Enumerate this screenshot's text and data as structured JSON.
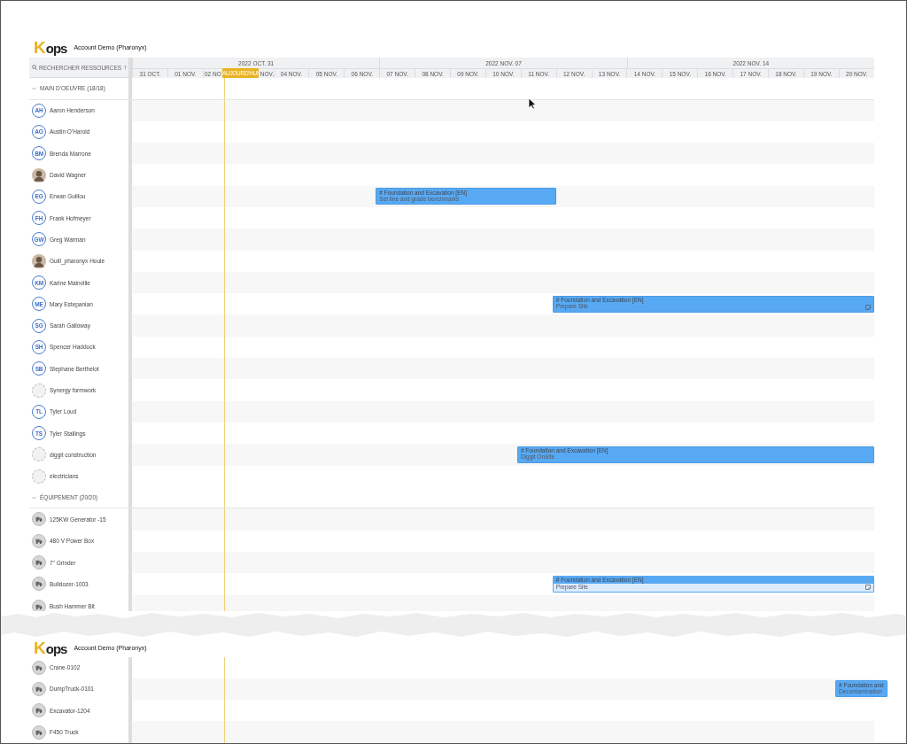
{
  "search": {
    "placeholder": "RECHERCHER RESSOURCES"
  },
  "timeline": {
    "weeks": [
      "2022 OCT. 31",
      "2022 NOV. 07",
      "2022 NOV. 14"
    ],
    "days": [
      "31 OCT.",
      "01 NOV.",
      "02 NO",
      "NOV.",
      "04 NOV.",
      "05 NOV.",
      "06 NOV.",
      "07 NOV.",
      "08 NOV.",
      "09 NOV.",
      "10 NOV.",
      "11 NOV.",
      "12 NOV.",
      "13 NOV.",
      "14 NOV.",
      "15 NOV.",
      "16 NOV.",
      "17 NOV.",
      "18 NOV.",
      "19 NOV.",
      "20 NOV."
    ],
    "today": {
      "label": "AUJOURD'HUI",
      "level": 0.1238
    }
  },
  "segments": [
    {
      "show_header": true,
      "header": {
        "logo": {
          "mark": "K",
          "text": "ops"
        },
        "account": "Account Demo (Pharonyx)"
      },
      "show_columns": true,
      "torn_below": true,
      "groups": [
        {
          "label": "MAIN D'OEUVRE (18/18)",
          "expanded": true,
          "rows": [
            {
              "name": "Aaron Henderson",
              "avatar": {
                "kind": "initials",
                "text": "AH"
              }
            },
            {
              "name": "Austin O'Harold",
              "avatar": {
                "kind": "initials",
                "text": "AO"
              }
            },
            {
              "name": "Brenda Marrone",
              "avatar": {
                "kind": "initials",
                "text": "BM"
              }
            },
            {
              "name": "David Wagner",
              "avatar": {
                "kind": "photo"
              }
            },
            {
              "name": "Erwan Guillou",
              "avatar": {
                "kind": "initials",
                "text": "EG"
              },
              "tasks": [
                {
                  "kind": "solid",
                  "title": "# Foundation and Excavation [EN]",
                  "subtitle": "Set line and grade benchmarks",
                  "note_icon": false
                }
              ]
            },
            {
              "name": "Frank Hofmeyer",
              "avatar": {
                "kind": "initials",
                "text": "FH"
              }
            },
            {
              "name": "Greg Warman",
              "avatar": {
                "kind": "initials",
                "text": "GW"
              }
            },
            {
              "name": "Guill_pharonyx Houle",
              "avatar": {
                "kind": "photo"
              }
            },
            {
              "name": "Karine Mainville",
              "avatar": {
                "kind": "initials",
                "text": "KM"
              }
            },
            {
              "name": "Mary Estepanian",
              "avatar": {
                "kind": "initials",
                "text": "ME"
              },
              "tasks": [
                {
                  "kind": "solid",
                  "title": "# Foundation and Excavation [EN]",
                  "subtitle": "Prepare Site",
                  "note_icon": true
                }
              ]
            },
            {
              "name": "Sarah Galloway",
              "avatar": {
                "kind": "initials",
                "text": "SG"
              }
            },
            {
              "name": "Spencer Haddock",
              "avatar": {
                "kind": "initials",
                "text": "SH"
              }
            },
            {
              "name": "Stephane Berthelot",
              "avatar": {
                "kind": "initials",
                "text": "SB"
              }
            },
            {
              "name": "Synergy formwork",
              "avatar": {
                "kind": "placeholder"
              }
            },
            {
              "name": "Tyler Loud",
              "avatar": {
                "kind": "initials",
                "text": "TL"
              }
            },
            {
              "name": "Tyler Stallings",
              "avatar": {
                "kind": "initials",
                "text": "TS"
              }
            },
            {
              "name": "diggit construction",
              "avatar": {
                "kind": "placeholder"
              },
              "tasks": [
                {
                  "kind": "solid",
                  "title": "# Foundation and Excavation [EN]",
                  "subtitle": "Diggit OnSite",
                  "note_icon": false
                }
              ]
            },
            {
              "name": "electricians",
              "avatar": {
                "kind": "placeholder"
              }
            }
          ]
        },
        {
          "label": "ÉQUIPEMENT (20/20)",
          "expanded": true,
          "rows": [
            {
              "name": "125KW Generator -15",
              "avatar": {
                "kind": "equipment"
              }
            },
            {
              "name": "480 V Power Box",
              "avatar": {
                "kind": "equipment"
              }
            },
            {
              "name": "7\" Grinder",
              "avatar": {
                "kind": "equipment"
              }
            },
            {
              "name": "Bulldozer-1003",
              "avatar": {
                "kind": "equipment"
              },
              "tasks": [
                {
                  "kind": "light",
                  "title": "# Foundation and Excavation [EN]",
                  "subtitle": "Prepare Site",
                  "note_icon": true
                }
              ]
            },
            {
              "name": "Bush Hammer Bit",
              "avatar": {
                "kind": "equipment"
              }
            }
          ]
        }
      ]
    },
    {
      "show_header": true,
      "header": {
        "logo": {
          "mark": "K",
          "text": "ops"
        },
        "account": "Account Demo (Pharonyx)"
      },
      "show_columns": false,
      "torn_below": false,
      "groups": [
        {
          "rows": [
            {
              "name": "Crane-0102",
              "avatar": {
                "kind": "equipment"
              }
            },
            {
              "name": "DumpTruck-0101",
              "avatar": {
                "kind": "equipment"
              },
              "tasks": [
                {
                  "kind": "solid",
                  "title": "# Foundation and",
                  "subtitle": "Decontamination",
                  "note_icon": false
                }
              ]
            },
            {
              "name": "Excavator-1204",
              "avatar": {
                "kind": "equipment"
              }
            },
            {
              "name": "F450 Truck",
              "avatar": {
                "kind": "equipment"
              }
            }
          ]
        }
      ]
    }
  ]
}
